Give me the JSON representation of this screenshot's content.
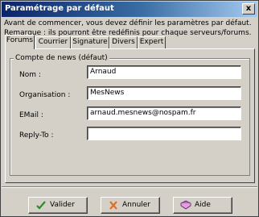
{
  "window": {
    "title": "Paramétrage par défaut",
    "close_label": "x"
  },
  "intro": {
    "line1": "Avant de commencer, vous devez définir les paramètres par défaut.",
    "line2": "Remarque : ils pourront être redéfinis pour chaque serveurs/forums."
  },
  "tabs": [
    {
      "label": "Forums"
    },
    {
      "label": "Courrier"
    },
    {
      "label": "Signature"
    },
    {
      "label": "Divers"
    },
    {
      "label": "Expert"
    }
  ],
  "group": {
    "title": "Compte de news (défaut)"
  },
  "fields": {
    "nom": {
      "label": "Nom :",
      "value": "Arnaud"
    },
    "organisation": {
      "label": "Organisation :",
      "value": "MesNews"
    },
    "email": {
      "label": "EMail :",
      "value": "arnaud.mesnews@nospam.fr"
    },
    "replyto": {
      "label": "Reply-To :",
      "value": ""
    }
  },
  "buttons": {
    "valider": {
      "label": "Valider",
      "icon": "check-icon"
    },
    "annuler": {
      "label": "Annuler",
      "icon": "x-icon"
    },
    "aide": {
      "label": "Aide",
      "icon": "help-book-icon"
    }
  },
  "colors": {
    "title_start": "#0a246a",
    "title_end": "#a6caf0",
    "face": "#d4d0c8"
  }
}
